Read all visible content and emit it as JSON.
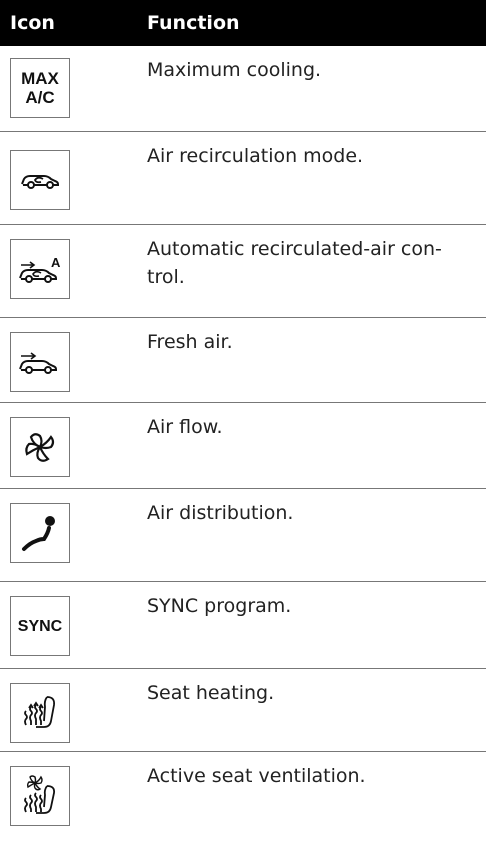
{
  "header": {
    "icon_label": "Icon",
    "function_label": "Function"
  },
  "rows": [
    {
      "icon": "max-ac-icon",
      "icon_text": [
        "MAX",
        "A/C"
      ],
      "function": "Maximum cooling."
    },
    {
      "icon": "air-recirculation-icon",
      "function": "Air recirculation mode."
    },
    {
      "icon": "automatic-recirculation-icon",
      "icon_text": [
        "A"
      ],
      "function": "Automatic recirculated-air con-trol."
    },
    {
      "icon": "fresh-air-icon",
      "function": "Fresh air."
    },
    {
      "icon": "fan-icon",
      "function": "Air flow."
    },
    {
      "icon": "air-distribution-icon",
      "function": "Air distribution."
    },
    {
      "icon": "sync-icon",
      "icon_text": [
        "SYNC"
      ],
      "function": "SYNC program."
    },
    {
      "icon": "seat-heating-icon",
      "function": "Seat heating."
    },
    {
      "icon": "seat-ventilation-icon",
      "function": "Active seat ventilation."
    }
  ]
}
